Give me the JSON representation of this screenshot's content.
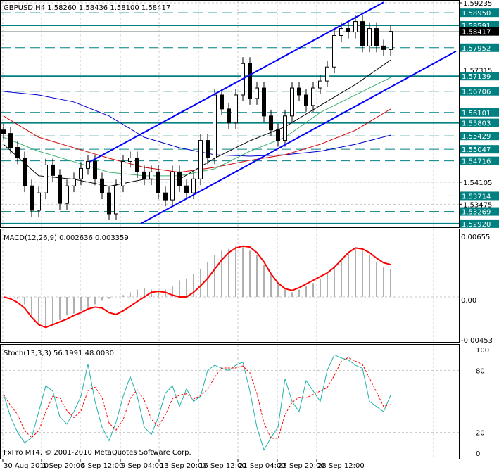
{
  "header": {
    "symbol": "GBPUSD,H4",
    "open": "1.58260",
    "high": "1.58436",
    "low": "1.58100",
    "close": "1.58417"
  },
  "copyright": "FxPro MT4, © 2001-2010 MetaQuotes Software Corp.",
  "colors": {
    "level": "#008080",
    "channel": "#0000ff",
    "ma_blue": "#0000cd",
    "ma_red": "#d00000",
    "ma_green": "#3cb371",
    "ma_black": "#000000",
    "macd_hist": "#b0b0b0",
    "macd_signal": "#ff0000",
    "stoch_main": "#20b2aa",
    "stoch_signal": "#ff0000"
  },
  "chart_data": [
    {
      "type": "candlestick",
      "title": "GBPUSD,H4",
      "ylim": [
        1.5292,
        1.59235
      ],
      "price_ticks": [
        "1.59235",
        "1.57315",
        "1.54105",
        "1.53475"
      ],
      "levels": [
        {
          "price": 1.5895,
          "label": "1.58950",
          "style": "dashed"
        },
        {
          "price": 1.58591,
          "label": "1.58591",
          "style": "solid"
        },
        {
          "price": 1.57952,
          "label": "1.57952",
          "style": "dashed"
        },
        {
          "price": 1.57139,
          "label": "1.57139",
          "style": "solid"
        },
        {
          "price": 1.56706,
          "label": "1.56706",
          "style": "dashed"
        },
        {
          "price": 1.56101,
          "label": "1.56101",
          "style": "dashed"
        },
        {
          "price": 1.55803,
          "label": "1.55803",
          "style": "solid"
        },
        {
          "price": 1.55429,
          "label": "1.55429",
          "style": "dashed"
        },
        {
          "price": 1.55047,
          "label": "1.55047",
          "style": "dashed"
        },
        {
          "price": 1.54716,
          "label": "1.54716",
          "style": "dashed"
        },
        {
          "price": 1.53714,
          "label": "1.53714",
          "style": "dashed"
        },
        {
          "price": 1.53269,
          "label": "1.53269",
          "style": "dashed"
        },
        {
          "price": 1.5292,
          "label": "1.52920",
          "style": "solid"
        }
      ],
      "bid": {
        "price": 1.58417,
        "label": "1.58417"
      },
      "closes": [
        1.555,
        1.551,
        1.548,
        1.54,
        1.533,
        1.538,
        1.546,
        1.543,
        1.535,
        1.54,
        1.542,
        1.545,
        1.547,
        1.542,
        1.538,
        1.532,
        1.54,
        1.547,
        1.548,
        1.544,
        1.542,
        1.544,
        1.538,
        1.536,
        1.544,
        1.54,
        1.538,
        1.542,
        1.553,
        1.548,
        1.566,
        1.562,
        1.558,
        1.566,
        1.575,
        1.565,
        1.568,
        1.56,
        1.556,
        1.553,
        1.56,
        1.568,
        1.566,
        1.563,
        1.568,
        1.57,
        1.574,
        1.583,
        1.585,
        1.584,
        1.587,
        1.58,
        1.585,
        1.58,
        1.579,
        1.58417
      ],
      "moving_averages_every_5_bars": {
        "blue": [
          1.567,
          1.566,
          1.564,
          1.56,
          1.5539,
          1.5509,
          1.5489,
          1.5485,
          1.5489,
          1.5499,
          1.5519,
          1.5545
        ],
        "red": [
          1.56,
          1.5539,
          1.5509,
          1.5479,
          1.5453,
          1.5439,
          1.5453,
          1.5473,
          1.5489,
          1.5519,
          1.5559,
          1.562
        ],
        "green": [
          1.5539,
          1.5499,
          1.5469,
          1.5439,
          1.5429,
          1.5429,
          1.5449,
          1.5499,
          1.5539,
          1.561,
          1.566,
          1.571
        ],
        "black": [
          1.5519,
          1.5429,
          1.5419,
          1.5399,
          1.5419,
          1.5419,
          1.5479,
          1.5529,
          1.5569,
          1.563,
          1.569,
          1.576
        ]
      },
      "channel": {
        "upper": [
          {
            "bar": 12.3,
            "price": 1.5469
          },
          {
            "bar": 54,
            "price": 1.5925
          }
        ],
        "lower": [
          {
            "bar": 19.5,
            "price": 1.5292
          },
          {
            "bar": 64.3,
            "price": 1.5785
          }
        ]
      }
    },
    {
      "type": "bar+line",
      "title": "MACD(12,26,9) 0.002636 0.003359",
      "label": "MACD(12,26,9)",
      "value_main": "0.002636",
      "value_signal": "0.003359",
      "ylim": [
        -0.00453,
        0.00655
      ],
      "ticks": [
        "0.00655",
        "0.00",
        "-0.00453"
      ],
      "histogram_e4": [
        0,
        0,
        -2,
        -8,
        -20,
        -30,
        -33,
        -30,
        -25,
        -20,
        -18,
        -15,
        -12,
        -8,
        -4,
        -2,
        0,
        2,
        5,
        8,
        10,
        8,
        6,
        8,
        12,
        18,
        20,
        25,
        30,
        38,
        45,
        50,
        52,
        55,
        54,
        50,
        45,
        35,
        25,
        15,
        8,
        5,
        8,
        12,
        15,
        20,
        25,
        32,
        40,
        48,
        52,
        50,
        45,
        38,
        32,
        30
      ],
      "signal_e4": [
        0,
        -2,
        -6,
        -12,
        -22,
        -30,
        -33,
        -30,
        -27,
        -24,
        -20,
        -17,
        -13,
        -11,
        -12,
        -17,
        -19,
        -15,
        -10,
        -5,
        0,
        5,
        6,
        5,
        2,
        0,
        0,
        5,
        12,
        20,
        30,
        40,
        48,
        53,
        55,
        54,
        48,
        38,
        25,
        15,
        9,
        7,
        10,
        14,
        18,
        22,
        26,
        32,
        40,
        48,
        53,
        52,
        48,
        42,
        37,
        35
      ]
    },
    {
      "type": "line",
      "title": "Stoch(13,3,3) 56.1991 48.0030",
      "label": "Stoch(13,3,3)",
      "value_main": "56.1991",
      "value_signal": "48.0030",
      "ylim": [
        0,
        100
      ],
      "ticks": [
        "100",
        "80",
        "20",
        "0"
      ],
      "main": [
        57,
        35,
        20,
        10,
        15,
        40,
        65,
        60,
        35,
        28,
        40,
        55,
        86,
        50,
        25,
        12,
        30,
        55,
        74,
        55,
        25,
        18,
        35,
        58,
        65,
        45,
        62,
        50,
        55,
        80,
        85,
        82,
        80,
        85,
        88,
        60,
        25,
        3,
        15,
        25,
        72,
        50,
        40,
        70,
        60,
        50,
        80,
        95,
        92,
        90,
        85,
        82,
        50,
        45,
        40,
        56
      ]
    }
  ],
  "time_axis": [
    "30 Aug 2010",
    "1 Sep 20:00",
    "6 Sep 12:00",
    "9 Sep 04:00",
    "13 Sep 20:00",
    "16 Sep 12:00",
    "21 Sep 04:00",
    "23 Sep 20:00",
    "28 Sep 12:00"
  ]
}
